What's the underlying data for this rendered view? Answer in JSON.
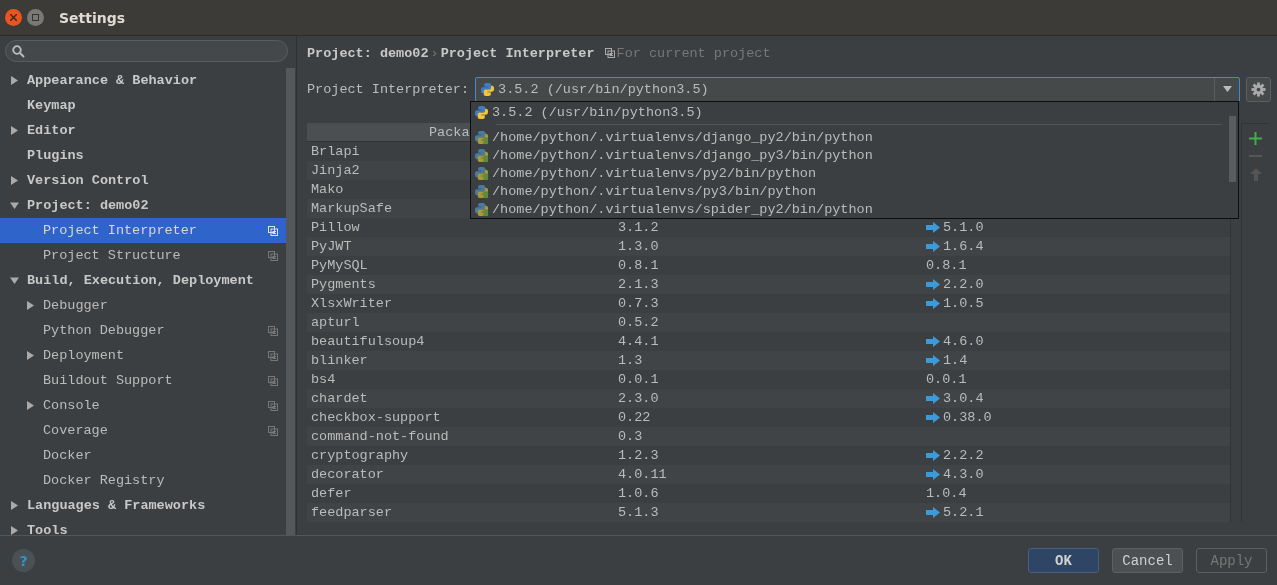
{
  "window": {
    "title": "Settings"
  },
  "sidebar": {
    "items": [
      {
        "label": "Appearance & Behavior",
        "expanded": false,
        "selected": false,
        "project_scoped": false
      },
      {
        "label": "Keymap",
        "selected": false,
        "project_scoped": false
      },
      {
        "label": "Editor",
        "expanded": false,
        "selected": false,
        "project_scoped": false
      },
      {
        "label": "Plugins",
        "selected": false,
        "project_scoped": false
      },
      {
        "label": "Version Control",
        "expanded": false,
        "selected": false,
        "project_scoped": false
      },
      {
        "label": "Project: demo02",
        "expanded": true,
        "selected": false,
        "project_scoped": false,
        "children": [
          {
            "label": "Project Interpreter",
            "selected": true,
            "project_scoped": true
          },
          {
            "label": "Project Structure",
            "selected": false,
            "project_scoped": true
          }
        ]
      },
      {
        "label": "Build, Execution, Deployment",
        "expanded": true,
        "selected": false,
        "project_scoped": false,
        "children": [
          {
            "label": "Debugger",
            "expanded": false,
            "selected": false,
            "project_scoped": false
          },
          {
            "label": "Python Debugger",
            "selected": false,
            "project_scoped": true
          },
          {
            "label": "Deployment",
            "expanded": false,
            "selected": false,
            "project_scoped": true
          },
          {
            "label": "Buildout Support",
            "selected": false,
            "project_scoped": true
          },
          {
            "label": "Console",
            "expanded": false,
            "selected": false,
            "project_scoped": true
          },
          {
            "label": "Coverage",
            "selected": false,
            "project_scoped": true
          },
          {
            "label": "Docker",
            "selected": false,
            "project_scoped": false
          },
          {
            "label": "Docker Registry",
            "selected": false,
            "project_scoped": false
          }
        ]
      },
      {
        "label": "Languages & Frameworks",
        "expanded": false,
        "selected": false,
        "project_scoped": false
      },
      {
        "label": "Tools",
        "expanded": false,
        "selected": false,
        "project_scoped": false
      }
    ]
  },
  "breadcrumb": {
    "parent": "Project: demo02",
    "separator": "›",
    "current": "Project Interpreter",
    "scope_note": "For current project"
  },
  "interpreter": {
    "label": "Project Interpreter:",
    "value": "3.5.2 (/usr/bin/python3.5)",
    "options": [
      {
        "label": "3.5.2 (/usr/bin/python3.5)",
        "kind": "system"
      },
      {
        "label": "/home/python/.virtualenvs/django_py2/bin/python",
        "kind": "virtualenv"
      },
      {
        "label": "/home/python/.virtualenvs/django_py3/bin/python",
        "kind": "virtualenv"
      },
      {
        "label": "/home/python/.virtualenvs/py2/bin/python",
        "kind": "virtualenv"
      },
      {
        "label": "/home/python/.virtualenvs/py3/bin/python",
        "kind": "virtualenv"
      },
      {
        "label": "/home/python/.virtualenvs/spider_py2/bin/python",
        "kind": "virtualenv"
      }
    ]
  },
  "table": {
    "columns": [
      "Packa"
    ],
    "rows": [
      {
        "name": "Brlapi"
      },
      {
        "name": "Jinja2"
      },
      {
        "name": "Mako"
      },
      {
        "name": "MarkupSafe"
      },
      {
        "name": "Pillow",
        "version": "3.1.2",
        "latest": "5.1.0",
        "upgrade": true
      },
      {
        "name": "PyJWT",
        "version": "1.3.0",
        "latest": "1.6.4",
        "upgrade": true
      },
      {
        "name": "PyMySQL",
        "version": "0.8.1",
        "latest": "0.8.1",
        "upgrade": false
      },
      {
        "name": "Pygments",
        "version": "2.1.3",
        "latest": "2.2.0",
        "upgrade": true
      },
      {
        "name": "XlsxWriter",
        "version": "0.7.3",
        "latest": "1.0.5",
        "upgrade": true
      },
      {
        "name": "apturl",
        "version": "0.5.2"
      },
      {
        "name": "beautifulsoup4",
        "version": "4.4.1",
        "latest": "4.6.0",
        "upgrade": true
      },
      {
        "name": "blinker",
        "version": "1.3",
        "latest": "1.4",
        "upgrade": true
      },
      {
        "name": "bs4",
        "version": "0.0.1",
        "latest": "0.0.1",
        "upgrade": false
      },
      {
        "name": "chardet",
        "version": "2.3.0",
        "latest": "3.0.4",
        "upgrade": true
      },
      {
        "name": "checkbox-support",
        "version": "0.22",
        "latest": "0.38.0",
        "upgrade": true
      },
      {
        "name": "command-not-found",
        "version": "0.3"
      },
      {
        "name": "cryptography",
        "version": "1.2.3",
        "latest": "2.2.2",
        "upgrade": true
      },
      {
        "name": "decorator",
        "version": "4.0.11",
        "latest": "4.3.0",
        "upgrade": true
      },
      {
        "name": "defer",
        "version": "1.0.6",
        "latest": "1.0.4",
        "upgrade": false
      },
      {
        "name": "feedparser",
        "version": "5.1.3",
        "latest": "5.2.1",
        "upgrade": true
      }
    ]
  },
  "help_button": "?",
  "buttons": [
    {
      "label": "OK",
      "default": true,
      "disabled": false
    },
    {
      "label": "Cancel",
      "default": false,
      "disabled": false
    },
    {
      "label": "Apply",
      "default": false,
      "disabled": true
    }
  ]
}
